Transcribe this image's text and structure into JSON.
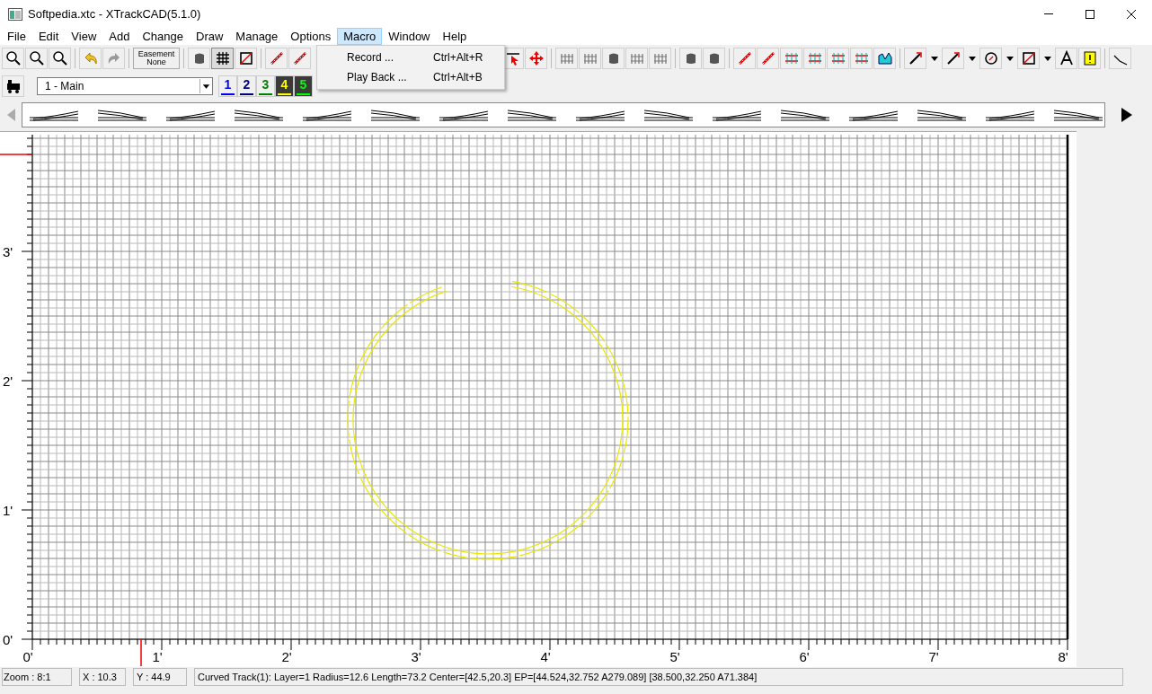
{
  "window": {
    "title": "Softpedia.xtc - XTrackCAD(5.1.0)"
  },
  "menu": [
    {
      "label": "File",
      "selected": false
    },
    {
      "label": "Edit",
      "selected": false
    },
    {
      "label": "View",
      "selected": false
    },
    {
      "label": "Add",
      "selected": false
    },
    {
      "label": "Change",
      "selected": false
    },
    {
      "label": "Draw",
      "selected": false
    },
    {
      "label": "Manage",
      "selected": false
    },
    {
      "label": "Options",
      "selected": false
    },
    {
      "label": "Macro",
      "selected": true
    },
    {
      "label": "Window",
      "selected": false
    },
    {
      "label": "Help",
      "selected": false
    }
  ],
  "dropdown": [
    {
      "label": "Record ...",
      "shortcut": "Ctrl+Alt+R"
    },
    {
      "label": "Play Back ...",
      "shortcut": "Ctrl+Alt+B"
    }
  ],
  "easement_button": [
    "Easement",
    "None"
  ],
  "layer_select": {
    "value": "1 - Main"
  },
  "layers": [
    {
      "label": "1",
      "color": "#0000ff"
    },
    {
      "label": "2",
      "color": "#00007f"
    },
    {
      "label": "3",
      "color": "#008000"
    },
    {
      "label": "4",
      "color": "#ffff00"
    },
    {
      "label": "5",
      "color": "#00ff00"
    }
  ],
  "rulers": {
    "x_labels": [
      "0'",
      "1'",
      "2'",
      "3'",
      "4'",
      "5'",
      "6'",
      "7'",
      "8'"
    ],
    "y_labels": [
      "3'",
      "2'",
      "1'",
      "0'"
    ]
  },
  "status_bar": {
    "zoom": "Zoom : 8:1",
    "x": "X : 10.3",
    "y": "Y : 44.9",
    "message": "Curved Track(1): Layer=1 Radius=12.6 Length=73.2 Center=[42.5,20.3] EP=[44.524,32.752 A279.089] [38.500,32.250 A71.384]"
  }
}
